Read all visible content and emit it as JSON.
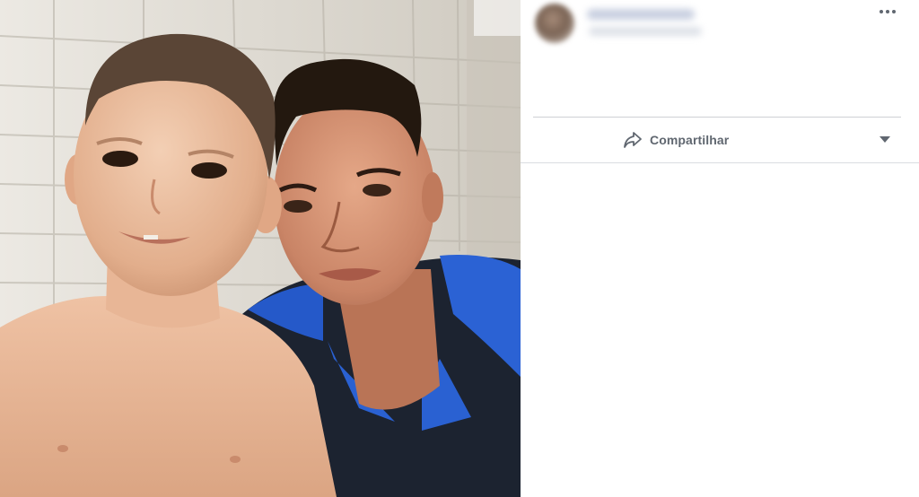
{
  "post": {
    "photo": {
      "subject": "selfie-photo"
    },
    "header": {
      "more_icon": "more-horizontal-icon"
    },
    "actions": {
      "share_label": "Compartilhar",
      "share_icon": "share-arrow-icon",
      "audience_dropdown_icon": "caret-down-icon"
    }
  },
  "colors": {
    "text_secondary": "#606770",
    "divider": "#ced0d4",
    "background": "#ffffff",
    "shirt_blue": "#1a4fb8",
    "shirt_dark": "#1c2330"
  }
}
